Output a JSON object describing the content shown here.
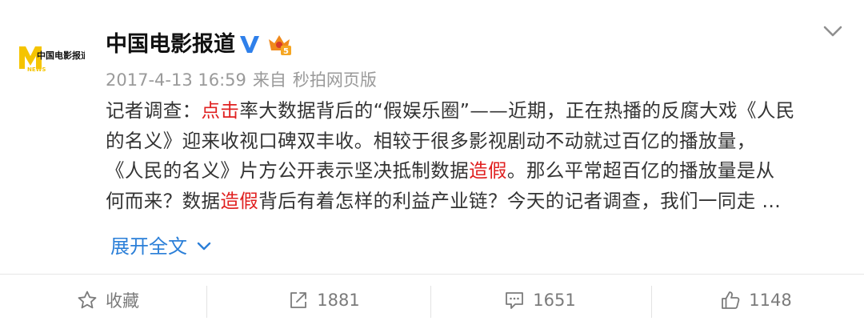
{
  "post": {
    "author": "中国电影报道",
    "avatar_text": "中国电影报道",
    "avatar_sub": "NEWS",
    "vip_level": "5",
    "meta": {
      "timestamp": "2017-4-13 16:59",
      "source_prefix": "来自",
      "source": "秒拍网页版"
    },
    "content": {
      "l1_a": "记者调查：",
      "l1_red": "点击",
      "l1_b": "率大数据背后的“假娱乐圈”——近期，正在热播的反腐大戏《人民",
      "l2": "的名义》迎来收视口碑双丰收。相较于很多影视剧动不动就过百亿的播放量，",
      "l3_a": "《人民的名义》片方公开表示坚决抵制数据",
      "l3_red": "造假",
      "l3_b": "。那么平常超百亿的播放量是从",
      "l4_a": "何而来？数据",
      "l4_red": "造假",
      "l4_b": "背后有着怎样的利益产业链？今天的记者调查，我们一同走 ..."
    },
    "expand_label": "展开全文"
  },
  "actions": {
    "favorite_label": "收藏",
    "repost_count": "1881",
    "comment_count": "1651",
    "like_count": "1148"
  },
  "colors": {
    "link": "#2b7fd8",
    "highlight": "#e02020",
    "verified": "#2f80ea",
    "brand_yellow": "#f5c400",
    "vip_orange": "#f08a1c"
  },
  "icons": [
    "verified-icon",
    "vip-crown-icon",
    "chevron-down-icon",
    "star-icon",
    "share-icon",
    "comment-icon",
    "like-icon"
  ]
}
